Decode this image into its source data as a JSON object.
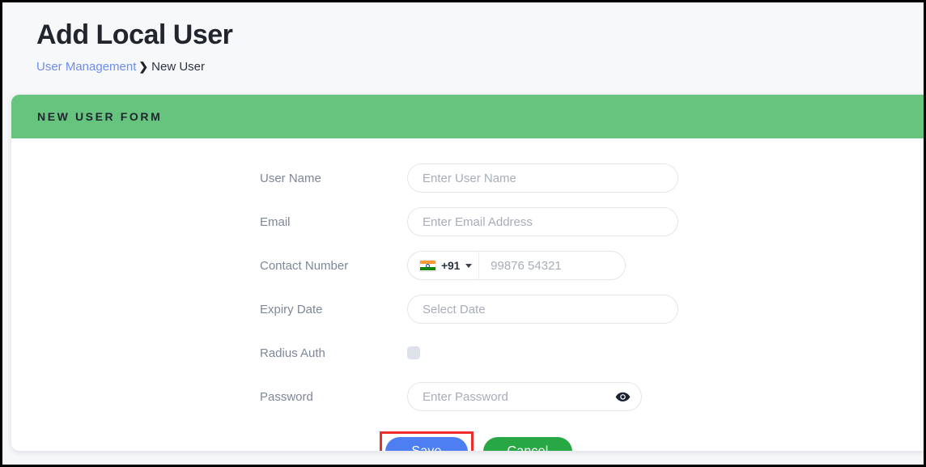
{
  "page": {
    "title": "Add Local User",
    "breadcrumb": {
      "link": "User Management",
      "separator": "❯",
      "current": "New User"
    }
  },
  "card": {
    "header_title": "NEW USER FORM",
    "header_color": "#66C47E"
  },
  "form": {
    "fields": [
      {
        "label": "User Name",
        "placeholder": "Enter User Name",
        "value": "",
        "type": "text"
      },
      {
        "label": "Email",
        "placeholder": "Enter Email Address",
        "value": "",
        "type": "text"
      },
      {
        "label": "Contact Number",
        "placeholder": "99876 54321",
        "value": "",
        "type": "phone"
      },
      {
        "label": "Expiry Date",
        "placeholder": "Select Date",
        "value": "",
        "type": "date"
      },
      {
        "label": "Radius Auth",
        "placeholder": "",
        "value": "",
        "type": "checkbox",
        "checked": false
      },
      {
        "label": "Password",
        "placeholder": "Enter Password",
        "value": "",
        "type": "password"
      }
    ],
    "phone": {
      "country_code": "+91",
      "flag": "india-flag-icon",
      "dropdown_icon": "chevron-down-icon"
    },
    "password_toggle_icon": "eye-icon"
  },
  "actions": {
    "save_label": "Save",
    "save_color": "#4D7FF3",
    "cancel_label": "Cancel",
    "cancel_color": "#28A745"
  },
  "annotation": {
    "highlight_color": "#EE2C2C",
    "target": "save-button"
  }
}
